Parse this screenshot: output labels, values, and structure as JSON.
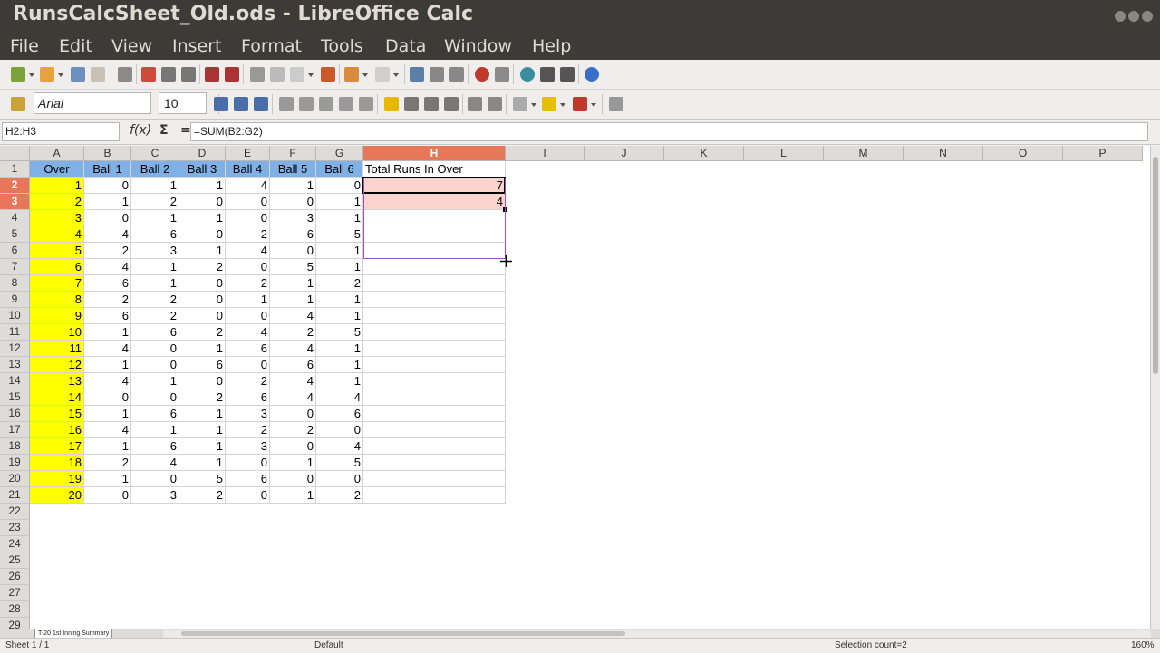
{
  "window": {
    "title": "RunsCalcSheet_Old.ods - LibreOffice Calc"
  },
  "menu": [
    "File",
    "Edit",
    "View",
    "Insert",
    "Format",
    "Tools",
    "Data",
    "Window",
    "Help"
  ],
  "toolbar": {
    "font_name": "Arial",
    "font_size": "10"
  },
  "formula_bar": {
    "name_box": "H2:H3",
    "fx_label": "f(x)",
    "sum_label": "Σ",
    "equals_label": "=",
    "formula": "=SUM(B2:G2)"
  },
  "columns": [
    "A",
    "B",
    "C",
    "D",
    "E",
    "F",
    "G",
    "H",
    "I",
    "J",
    "K",
    "L",
    "M",
    "N",
    "O",
    "P"
  ],
  "selected_column": "H",
  "selected_rows": [
    2,
    3
  ],
  "headers": [
    "Over",
    "Ball 1",
    "Ball 2",
    "Ball 3",
    "Ball 4",
    "Ball 5",
    "Ball 6",
    "Total Runs In Over"
  ],
  "rows": [
    [
      1,
      0,
      1,
      1,
      4,
      1,
      0,
      7
    ],
    [
      2,
      1,
      2,
      0,
      0,
      0,
      1,
      4
    ],
    [
      3,
      0,
      1,
      1,
      0,
      3,
      1,
      null
    ],
    [
      4,
      4,
      6,
      0,
      2,
      6,
      5,
      null
    ],
    [
      5,
      2,
      3,
      1,
      4,
      0,
      1,
      null
    ],
    [
      6,
      4,
      1,
      2,
      0,
      5,
      1,
      null
    ],
    [
      7,
      6,
      1,
      0,
      2,
      1,
      2,
      null
    ],
    [
      8,
      2,
      2,
      0,
      1,
      1,
      1,
      null
    ],
    [
      9,
      6,
      2,
      0,
      0,
      4,
      1,
      null
    ],
    [
      10,
      1,
      6,
      2,
      4,
      2,
      5,
      null
    ],
    [
      11,
      4,
      0,
      1,
      6,
      4,
      1,
      null
    ],
    [
      12,
      1,
      0,
      6,
      0,
      6,
      1,
      null
    ],
    [
      13,
      4,
      1,
      0,
      2,
      4,
      1,
      null
    ],
    [
      14,
      0,
      0,
      2,
      6,
      4,
      4,
      null
    ],
    [
      15,
      1,
      6,
      1,
      3,
      0,
      6,
      null
    ],
    [
      16,
      4,
      1,
      1,
      2,
      2,
      0,
      null
    ],
    [
      17,
      1,
      6,
      1,
      3,
      0,
      4,
      null
    ],
    [
      18,
      2,
      4,
      1,
      0,
      1,
      5,
      null
    ],
    [
      19,
      1,
      0,
      5,
      6,
      0,
      0,
      null
    ],
    [
      20,
      0,
      3,
      2,
      0,
      1,
      2,
      null
    ]
  ],
  "row_numbers": [
    1,
    2,
    3,
    4,
    5,
    6,
    7,
    8,
    9,
    10,
    11,
    12,
    13,
    14,
    15,
    16,
    17,
    18,
    19,
    20,
    21,
    22,
    23,
    24,
    25,
    26,
    27,
    28,
    29
  ],
  "sheet_tab": "T-20 1st Inning Summary",
  "status": {
    "sheet": "Sheet 1 / 1",
    "style": "Default",
    "selection": "Selection count=2",
    "zoom": "160%"
  },
  "colors": {
    "header_fill": "#7fb0e6",
    "over_fill": "#ffff00",
    "selection_accent": "#e8775a",
    "selection_fill": "#f8d4cc"
  }
}
